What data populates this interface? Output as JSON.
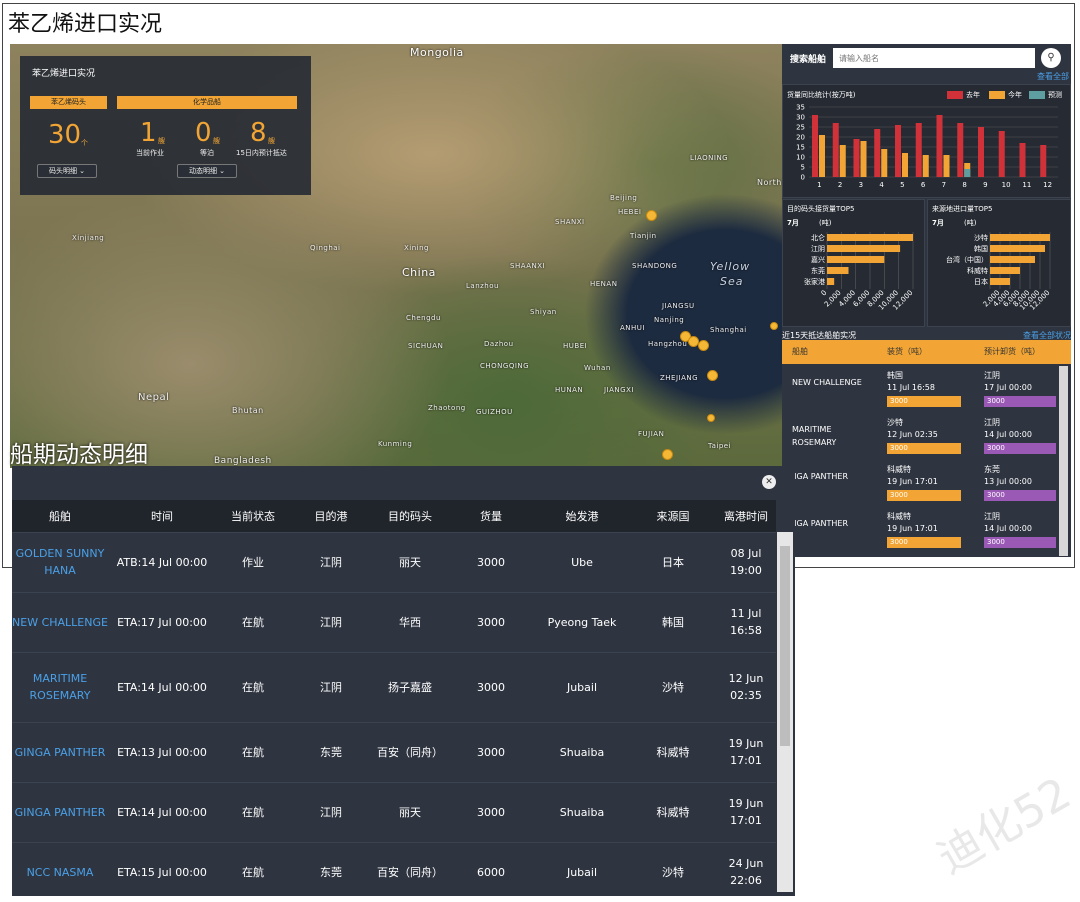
{
  "page_title": "苯乙烯进口实况",
  "map": {
    "labels": [
      "Mongolia",
      "China",
      "Nepal",
      "Bhutan",
      "Bangladesh",
      "Yellow",
      "Sea",
      "SHANXI",
      "HEBEI",
      "SHANDONG",
      "JIANGSU",
      "ANHUI",
      "HENAN",
      "SHAANXI",
      "SICHUAN",
      "CHONGQING",
      "HUBEI",
      "HUNAN",
      "GUIZHOU",
      "JIANGXI",
      "ZHEJIANG",
      "FUJIAN",
      "LIAONING",
      "North",
      "Taipei",
      "Chengdu",
      "Wuhan",
      "Hangzhou",
      "Shanghai",
      "Dazhou",
      "Nanjing",
      "Xinjiang",
      "Tianjin",
      "Beijing",
      "Zhaotong",
      "Kunming",
      "Shiyan",
      "Qinghai",
      "Lanzhou",
      "Xining"
    ],
    "ship_marker": "ship-marker",
    "overlay": {
      "title": "苯乙烯进口实况",
      "terminal_header": "苯乙烯码头",
      "terminal_count": "30",
      "terminal_unit": "个",
      "terminal_button": "码头明细 ⌄",
      "chem_header": "化学品船",
      "chem_items": [
        {
          "num": "1",
          "unit": "艘",
          "label": "当前作业"
        },
        {
          "num": "0",
          "unit": "艘",
          "label": "等泊"
        },
        {
          "num": "8",
          "unit": "艘",
          "label": "15日内预计抵达"
        }
      ],
      "chem_button": "动态明细 ⌄"
    }
  },
  "section_heading": "船期动态明细",
  "right_panel": {
    "search_label": "搜索船舶",
    "search_placeholder": "请输入船名",
    "search_icon": "search-icon",
    "see_all": "查看全部",
    "monthly_card": {
      "title": "货量同比统计(按万吨)",
      "legend": [
        "去年",
        "今年",
        "预测"
      ]
    },
    "top5_card": {
      "title": "目的码头接货量TOP5",
      "month": "7月",
      "unit": "(吨)"
    },
    "origin_card": {
      "title": "来源地进口量TOP5",
      "month": "7月",
      "unit": "(吨)"
    },
    "arrivals": {
      "title": "近15天抵达船舶实况",
      "link": "查看全部状况",
      "headers": [
        "船舶",
        "装货（吨）",
        "预计卸货（吨）"
      ],
      "rows": [
        {
          "ship": "NEW CHALLENGE",
          "load_country": "韩国",
          "load_date": "11 Jul 16:58",
          "load_qty": "3000",
          "unload_port": "江阴",
          "unload_date": "17 Jul 00:00",
          "unload_qty": "3000"
        },
        {
          "ship": "MARITIME ROSEMARY",
          "load_country": "沙特",
          "load_date": "12 Jun 02:35",
          "load_qty": "3000",
          "unload_port": "江阴",
          "unload_date": "14 Jul 00:00",
          "unload_qty": "3000"
        },
        {
          "ship": "GINGA PANTHER",
          "load_country": "科威特",
          "load_date": "19 Jun 17:01",
          "load_qty": "3000",
          "unload_port": "东莞",
          "unload_date": "13 Jul 00:00",
          "unload_qty": "3000"
        },
        {
          "ship": "GINGA PANTHER",
          "load_country": "科威特",
          "load_date": "19 Jun 17:01",
          "load_qty": "3000",
          "unload_port": "江阴",
          "unload_date": "14 Jul 00:00",
          "unload_qty": "3000"
        }
      ]
    }
  },
  "table": {
    "close_icon": "close-icon",
    "headers": [
      "船舶",
      "时间",
      "当前状态",
      "目的港",
      "目的码头",
      "货量",
      "始发港",
      "来源国",
      "离港时间"
    ],
    "rows": [
      {
        "ship": "GOLDEN SUNNY HANA",
        "time": "ATB:14 Jul 00:00",
        "status": "作业",
        "port": "江阴",
        "terminal": "丽天",
        "qty": "3000",
        "origin_port": "Ube",
        "country": "日本",
        "depart": "08 Jul 19:00"
      },
      {
        "ship": "NEW CHALLENGE",
        "time": "ETA:17 Jul 00:00",
        "status": "在航",
        "port": "江阴",
        "terminal": "华西",
        "qty": "3000",
        "origin_port": "Pyeong Taek",
        "country": "韩国",
        "depart": "11 Jul 16:58"
      },
      {
        "ship": "MARITIME ROSEMARY",
        "time": "ETA:14 Jul 00:00",
        "status": "在航",
        "port": "江阴",
        "terminal": "扬子嘉盛",
        "qty": "3000",
        "origin_port": "Jubail",
        "country": "沙特",
        "depart": "12 Jun 02:35"
      },
      {
        "ship": "GINGA PANTHER",
        "time": "ETA:13 Jul 00:00",
        "status": "在航",
        "port": "东莞",
        "terminal": "百安（同舟）",
        "qty": "3000",
        "origin_port": "Shuaiba",
        "country": "科威特",
        "depart": "19 Jun 17:01"
      },
      {
        "ship": "GINGA PANTHER",
        "time": "ETA:14 Jul 00:00",
        "status": "在航",
        "port": "江阴",
        "terminal": "丽天",
        "qty": "3000",
        "origin_port": "Shuaiba",
        "country": "科威特",
        "depart": "19 Jun 17:01"
      },
      {
        "ship": "NCC NASMA",
        "time": "ETA:15 Jul 00:00",
        "status": "在航",
        "port": "东莞",
        "terminal": "百安（同舟）",
        "qty": "6000",
        "origin_port": "Jubail",
        "country": "沙特",
        "depart": "24 Jun 22:06"
      }
    ]
  },
  "colors": {
    "accent": "#f2a534",
    "last_year": "#d1323a",
    "this_year": "#f2a534",
    "forecast": "#5f9ea0",
    "unload": "#9b59b6",
    "panel": "#2f3540",
    "link": "#4aa0e8"
  },
  "chart_data": [
    {
      "type": "bar",
      "title": "货量同比统计(按万吨)",
      "categories": [
        "1",
        "2",
        "3",
        "4",
        "5",
        "6",
        "7",
        "8",
        "9",
        "10",
        "11",
        "12"
      ],
      "series": [
        {
          "name": "去年",
          "values": [
            31,
            27,
            19,
            24,
            26,
            27,
            31,
            27,
            25,
            23,
            17,
            16
          ]
        },
        {
          "name": "今年",
          "values": [
            21,
            16,
            18,
            14,
            12,
            11,
            11,
            7,
            0,
            0,
            0,
            0
          ]
        },
        {
          "name": "预测",
          "values": [
            0,
            0,
            0,
            0,
            0,
            0,
            0,
            4,
            0,
            0,
            0,
            0
          ]
        }
      ],
      "ylim": [
        0,
        35
      ],
      "yticks": [
        0,
        5,
        10,
        15,
        20,
        25,
        30,
        35
      ],
      "legend": "top-right"
    },
    {
      "type": "bar",
      "orientation": "horizontal",
      "title": "目的码头接货量TOP5",
      "subtitle": "7月",
      "ylabel": "(吨)",
      "categories": [
        "北仑",
        "江阴",
        "嘉兴",
        "东莞",
        "张家港"
      ],
      "values": [
        12000,
        10200,
        8000,
        3000,
        1000
      ],
      "xlim": [
        0,
        12000
      ],
      "xticks": [
        "0",
        "2,000",
        "4,000",
        "6,000",
        "8,000",
        "10,000",
        "12,000"
      ]
    },
    {
      "type": "bar",
      "orientation": "horizontal",
      "title": "来源地进口量TOP5",
      "subtitle": "7月",
      "ylabel": "(吨)",
      "categories": [
        "沙特",
        "韩国",
        "台湾（中国）",
        "科威特",
        "日本"
      ],
      "values": [
        12000,
        11000,
        9000,
        6000,
        4000
      ],
      "xlim": [
        0,
        12000
      ],
      "xticks": [
        "2,000",
        "4,000",
        "6,000",
        "8,000",
        "10,000",
        "12,000"
      ]
    }
  ]
}
